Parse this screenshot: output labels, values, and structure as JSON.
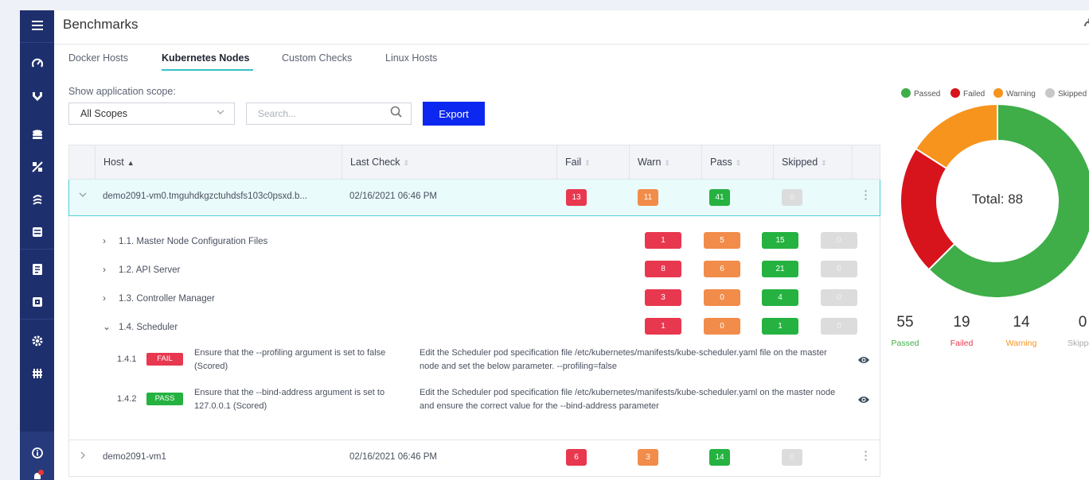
{
  "header": {
    "title": "Benchmarks"
  },
  "tabs": [
    {
      "label": "Docker Hosts"
    },
    {
      "label": "Kubernetes Nodes"
    },
    {
      "label": "Custom Checks"
    },
    {
      "label": "Linux Hosts"
    }
  ],
  "active_tab": "Kubernetes Nodes",
  "filters": {
    "scope_label": "Show application scope:",
    "scope_value": "All Scopes",
    "search_placeholder": "Search...",
    "export_label": "Export"
  },
  "table": {
    "columns": [
      "Host",
      "Last Check",
      "Fail",
      "Warn",
      "Pass",
      "Skipped"
    ],
    "sorted_column": "Host",
    "rows": [
      {
        "host": "demo2091-vm0.tmguhdkgzctuhdsfs103c0psxd.b...",
        "last_check": "02/16/2021 06:46 PM",
        "fail": "13",
        "warn": "11",
        "pass": "41",
        "skipped": "0",
        "expanded": true
      },
      {
        "host": "demo2091-vm1",
        "last_check": "02/16/2021 06:46 PM",
        "fail": "6",
        "warn": "3",
        "pass": "14",
        "skipped": "0",
        "expanded": false
      }
    ],
    "sections": [
      {
        "title": "1.1.  Master Node Configuration Files",
        "fail": "1",
        "warn": "5",
        "pass": "15",
        "skipped": "0",
        "open": false
      },
      {
        "title": "1.2.  API Server",
        "fail": "8",
        "warn": "6",
        "pass": "21",
        "skipped": "0",
        "open": false
      },
      {
        "title": "1.3.  Controller Manager",
        "fail": "3",
        "warn": "0",
        "pass": "4",
        "skipped": "0",
        "open": false
      },
      {
        "title": "1.4.  Scheduler",
        "fail": "1",
        "warn": "0",
        "pass": "1",
        "skipped": "0",
        "open": true
      }
    ],
    "checks": [
      {
        "id": "1.4.1",
        "status": "FAIL",
        "description": "Ensure that the --profiling argument is set to false (Scored)",
        "remediation": "Edit the Scheduler pod specification file /etc/kubernetes/manifests/kube-scheduler.yaml file on the master node and set the below parameter. --profiling=false"
      },
      {
        "id": "1.4.2",
        "status": "PASS",
        "description": "Ensure that the --bind-address argument is set to 127.0.0.1 (Scored)",
        "remediation": "Edit the Scheduler pod specification file /etc/kubernetes/manifests/kube-scheduler.yaml on the master node and ensure the correct value for the --bind-address parameter"
      }
    ]
  },
  "summary": {
    "legend": [
      "Passed",
      "Failed",
      "Warning",
      "Skipped"
    ],
    "total_label": "Total: 88",
    "stats": [
      {
        "value": "55",
        "label": "Passed"
      },
      {
        "value": "19",
        "label": "Failed"
      },
      {
        "value": "14",
        "label": "Warning"
      },
      {
        "value": "0",
        "label": "Skipped"
      }
    ]
  },
  "colors": {
    "passed": "#3fae49",
    "failed": "#d7141c",
    "warning": "#f7941d",
    "skipped": "#c8c8c8",
    "sidebar": "#1e2f6d",
    "accent": "#35c1c6",
    "export": "#0b27f0"
  },
  "icons": {
    "sidebar": [
      "menu-icon",
      "dashboard-icon",
      "shield-icon",
      "database-icon",
      "percent-icon",
      "network-icon",
      "server-icon",
      "report-icon",
      "image-icon",
      "settings-icon",
      "integrations-icon",
      "info-icon",
      "bell-icon"
    ]
  }
}
